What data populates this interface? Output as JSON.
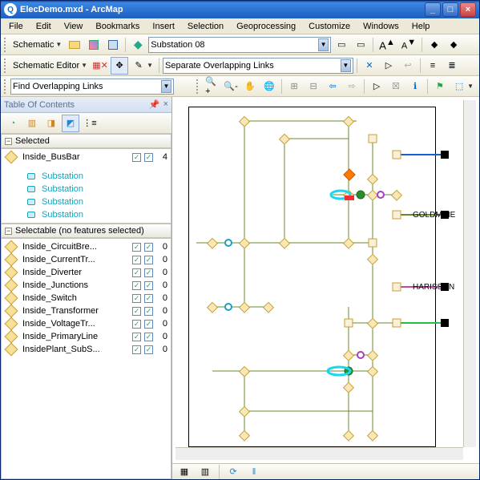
{
  "window": {
    "title": "ElecDemo.mxd - ArcMap"
  },
  "menu": [
    "File",
    "Edit",
    "View",
    "Bookmarks",
    "Insert",
    "Selection",
    "Geoprocessing",
    "Customize",
    "Windows",
    "Help"
  ],
  "tb1": {
    "schematic": "Schematic",
    "layer": "Substation 08"
  },
  "tb2": {
    "editor": "Schematic Editor",
    "task": "Separate Overlapping Links"
  },
  "tb3": {
    "find": "Find Overlapping Links"
  },
  "toc": {
    "title": "Table Of Contents",
    "selected_hdr": "Selected",
    "selectable_hdr": "Selectable (no features selected)",
    "busbar": {
      "name": "Inside_BusBar",
      "count": "4"
    },
    "substations": [
      "Substation",
      "Substation",
      "Substation",
      "Substation"
    ],
    "layers": [
      {
        "name": "Inside_CircuitBre...",
        "count": "0"
      },
      {
        "name": "Inside_CurrentTr...",
        "count": "0"
      },
      {
        "name": "Inside_Diverter",
        "count": "0"
      },
      {
        "name": "Inside_Junctions",
        "count": "0"
      },
      {
        "name": "Inside_Switch",
        "count": "0"
      },
      {
        "name": "Inside_Transformer",
        "count": "0"
      },
      {
        "name": "Inside_VoltageTr...",
        "count": "0"
      },
      {
        "name": "Inside_PrimaryLine",
        "count": "0"
      },
      {
        "name": "InsidePlant_SubS...",
        "count": "0"
      }
    ]
  },
  "map_labels": {
    "goldmine": "GOLDMINE",
    "harisson": "HARISSON"
  }
}
